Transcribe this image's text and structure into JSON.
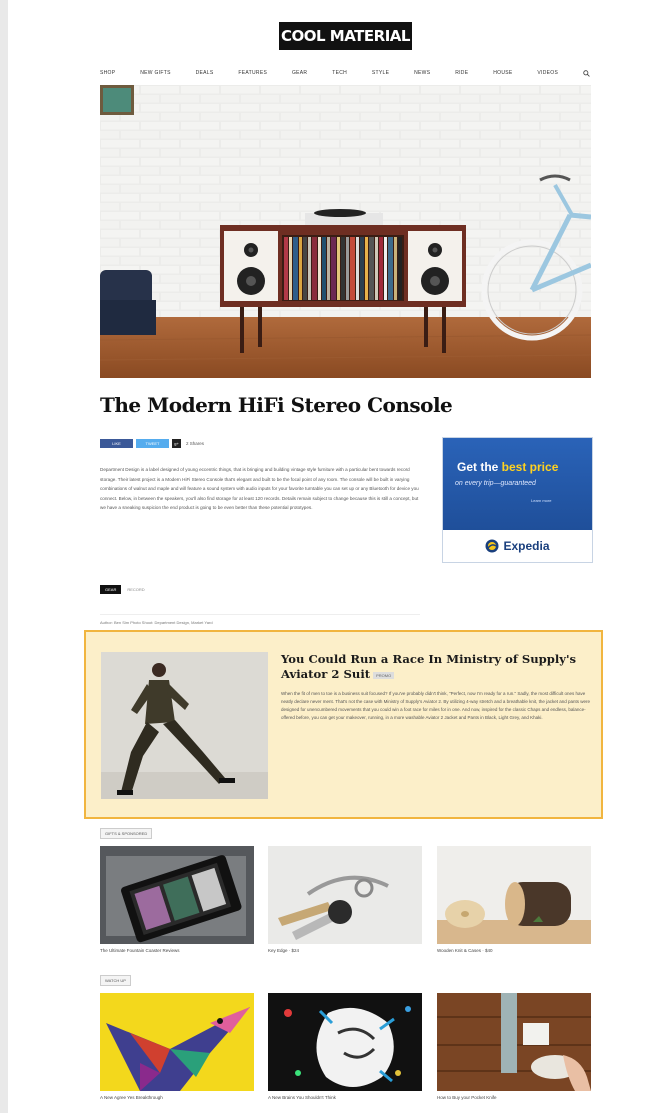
{
  "site": {
    "logo": "COOL MATERIAL"
  },
  "nav": {
    "items": [
      "SHOP",
      "NEW GIFTS",
      "DEALS",
      "FEATURES",
      "GEAR",
      "TECH",
      "STYLE",
      "NEWS",
      "RIDE",
      "HOUSE",
      "VIDEOS"
    ],
    "search_icon": "search-icon"
  },
  "article": {
    "title": "The Modern HiFi Stereo Console",
    "share": {
      "facebook": "LIKE",
      "twitter": "TWEET",
      "google": "g+",
      "count": "2 Shares"
    },
    "body": "Department Design is a label designed of young eccentric things, that is bringing and building vintage style furniture with a particular bent towards record storage. Their latest project is a Modern HiFi Stereo Console that's elegant and built to be the focal point of any room. The console will be built in varying combinations of walnut and maple and will feature a sound system with audio inputs for your favorite turntable you can set up or any Bluetooth for device you connect. Below, in between the speakers, you'll also find storage for at least 120 records. Details remain subject to change because this is still a concept, but we have a sneaking suspicion the end product is going to be even better than these potential prototypes.",
    "tags": [
      "GEAR",
      "RECORD"
    ],
    "credits": "Author: Ben Sim     Photo Shoot: Department Design, Market Yard"
  },
  "ad": {
    "line1_a": "Get the ",
    "line1_b": "best price",
    "line2": "on every trip—guaranteed",
    "line3": "Learn more",
    "brand": "Expedia"
  },
  "sponsored": {
    "title": "You Could Run a Race In Ministry of Supply's Aviator 2 Suit",
    "label": "PROMO",
    "body": "When the fit of men to toe is a business suit focused? If you've probably didn't think, \"Perfect, now I'm ready for a run.\" Sadly, the most difficult ones have neatly declare never ment. That's not the case with Ministry of Supply's Aviator 2. By utilizing 4-way stretch and a breathable knit, the jacket and pants were designed for unencumbered movements that you could win a foot race for miles for in one. And now, inspired for the classic Chaps and endless, balance-offered before, you can get your makeover, running, in a more washable Aviator 2 Jacket and Pants in Black, Light Grey, and Khaki."
  },
  "sections": [
    {
      "label": "GIFTS & SPONSORED",
      "items": [
        {
          "caption": "The Ultimate Fountain Coaster Reviews"
        },
        {
          "caption": "Key Edge · $24"
        },
        {
          "caption": "Wooden Knit & Cases · $40"
        }
      ]
    },
    {
      "label": "WATCH UP",
      "items": [
        {
          "caption": "A New Agree Yes Breakthrough"
        },
        {
          "caption": "A New Brains You Shouldn't Think"
        },
        {
          "caption": "How to Buy your Pocket Knife"
        }
      ]
    }
  ],
  "colors": {
    "sponsored_bg": "#fcefc9",
    "sponsored_border": "#f1b53f",
    "ad_blue": "#2a63b8",
    "facebook": "#3b5998",
    "twitter": "#55acee"
  }
}
